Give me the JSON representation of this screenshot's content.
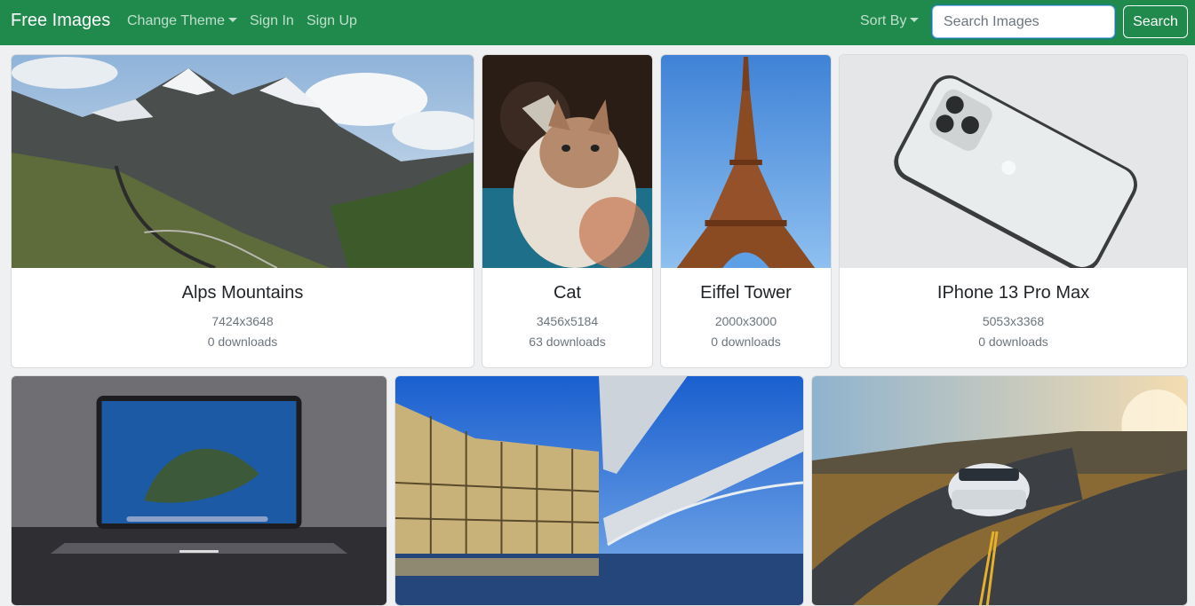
{
  "navbar": {
    "brand": "Free Images",
    "change_theme": "Change Theme",
    "sign_in": "Sign In",
    "sign_up": "Sign Up",
    "sort_by": "Sort By",
    "search_placeholder": "Search Images",
    "search_button": "Search"
  },
  "images": [
    {
      "title": "Alps Mountains",
      "size": "7424x3648",
      "downloads": "0 downloads"
    },
    {
      "title": "Cat",
      "size": "3456x5184",
      "downloads": "63 downloads"
    },
    {
      "title": "Eiffel Tower",
      "size": "2000x3000",
      "downloads": "0 downloads"
    },
    {
      "title": "IPhone 13 Pro Max",
      "size": "5053x3368",
      "downloads": "0 downloads"
    }
  ],
  "colors": {
    "navbar": "#1f8a4c",
    "page_bg": "#eef0f2"
  }
}
